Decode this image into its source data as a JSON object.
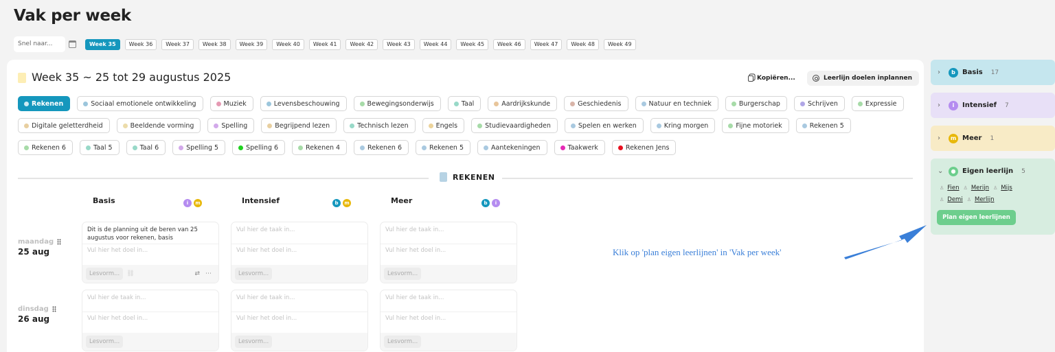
{
  "page": {
    "title": "Vak per week"
  },
  "weekbar": {
    "jump_placeholder": "Snel naar...",
    "calendar_icon": "calendar-icon",
    "weeks": [
      "Week 35",
      "Week 36",
      "Week 37",
      "Week 38",
      "Week 39",
      "Week 40",
      "Week 41",
      "Week 42",
      "Week 43",
      "Week 44",
      "Week 45",
      "Week 46",
      "Week 47",
      "Week 48",
      "Week 49"
    ],
    "active_week": "Week 35"
  },
  "main": {
    "week_title": "Week 35 ~ 25 tot 29 augustus 2025",
    "copy_label": "Kopiëren...",
    "plan_label": "Leerlijn doelen inplannen"
  },
  "subjects": [
    {
      "label": "Rekenen",
      "color": "#cfeaf3",
      "active": true
    },
    {
      "label": "Sociaal emotionele ontwikkeling",
      "color": "#9cc6dc"
    },
    {
      "label": "Muziek",
      "color": "#e59ab3"
    },
    {
      "label": "Levensbeschouwing",
      "color": "#9cc6dc"
    },
    {
      "label": "Bewegingsonderwijs",
      "color": "#a7dba8"
    },
    {
      "label": "Taal",
      "color": "#98d9c8"
    },
    {
      "label": "Aardrijkskunde",
      "color": "#e8c59a"
    },
    {
      "label": "Geschiedenis",
      "color": "#d8b4a8"
    },
    {
      "label": "Natuur en techniek",
      "color": "#a9c9e0"
    },
    {
      "label": "Burgerschap",
      "color": "#a7dba8"
    },
    {
      "label": "Schrijven",
      "color": "#b0a6e6"
    },
    {
      "label": "Expressie",
      "color": "#a7dba8"
    },
    {
      "label": "Digitale geletterdheid",
      "color": "#e8cfa0"
    },
    {
      "label": "Beeldende vorming",
      "color": "#ecdcaa"
    },
    {
      "label": "Spelling",
      "color": "#d2a9ea"
    },
    {
      "label": "Begrijpend lezen",
      "color": "#e8cfa0"
    },
    {
      "label": "Technisch lezen",
      "color": "#98d9c8"
    },
    {
      "label": "Engels",
      "color": "#ecd39b"
    },
    {
      "label": "Studievaardigheden",
      "color": "#a7dba8"
    },
    {
      "label": "Spelen en werken",
      "color": "#a9c9e0"
    },
    {
      "label": "Kring morgen",
      "color": "#a9c9e0"
    },
    {
      "label": "Fijne motoriek",
      "color": "#a7dba8"
    },
    {
      "label": "Rekenen 5",
      "color": "#a9c9e0"
    },
    {
      "label": "Rekenen 6",
      "color": "#a7dba8"
    },
    {
      "label": "Taal 5",
      "color": "#98d9c8"
    },
    {
      "label": "Taal 6",
      "color": "#98d9c8"
    },
    {
      "label": "Spelling 5",
      "color": "#d2a9ea"
    },
    {
      "label": "Spelling 6",
      "color": "#1fd11f"
    },
    {
      "label": "Rekenen 4",
      "color": "#a7dba8"
    },
    {
      "label": "Rekenen 6",
      "color": "#a9c9e0"
    },
    {
      "label": "Rekenen 5",
      "color": "#a9c9e0"
    },
    {
      "label": "Aantekeningen",
      "color": "#a9c9e0"
    },
    {
      "label": "Taakwerk",
      "color": "#e52bb6"
    },
    {
      "label": "Rekenen Jens",
      "color": "#e8101f"
    }
  ],
  "section": {
    "label": "REKENEN"
  },
  "columns": [
    {
      "title": "Basis",
      "badges": [
        "i",
        "m"
      ]
    },
    {
      "title": "Intensief",
      "badges": [
        "b",
        "m"
      ]
    },
    {
      "title": "Meer",
      "badges": [
        "b",
        "i"
      ]
    }
  ],
  "days": [
    {
      "name": "maandag",
      "date": "25 aug"
    },
    {
      "name": "dinsdag",
      "date": "26 aug"
    }
  ],
  "cards": {
    "filled_task": "Dit is de planning uit de beren van 25 augustus voor rekenen, basis",
    "task_placeholder": "Vul hier de taak in...",
    "goal_placeholder": "Vul hier het doel in...",
    "lesvorm": "Lesvorm..."
  },
  "annotation": "Klik op 'plan eigen leerlijnen' in 'Vak per week'",
  "sidebar": {
    "groups": [
      {
        "letter": "b",
        "name": "Basis",
        "count": "17",
        "bg": "#c5e6ee",
        "badge": "#1597bd",
        "chevron": "›"
      },
      {
        "letter": "i",
        "name": "Intensief",
        "count": "7",
        "bg": "#e8e0f7",
        "badge": "#b58cf0",
        "chevron": "›"
      },
      {
        "letter": "m",
        "name": "Meer",
        "count": "1",
        "bg": "#f8ebc6",
        "badge": "#e8b80a",
        "chevron": "›"
      }
    ],
    "eigen": {
      "name": "Eigen leerlijn",
      "count": "5",
      "bg": "#d7ede0",
      "badge": "#6dce8d",
      "chevron": "⌄",
      "students": [
        "Fien",
        "Merijn",
        "Mijs",
        "Demi",
        "Merlijn"
      ],
      "button": "Plan eigen leerlijnen"
    }
  }
}
